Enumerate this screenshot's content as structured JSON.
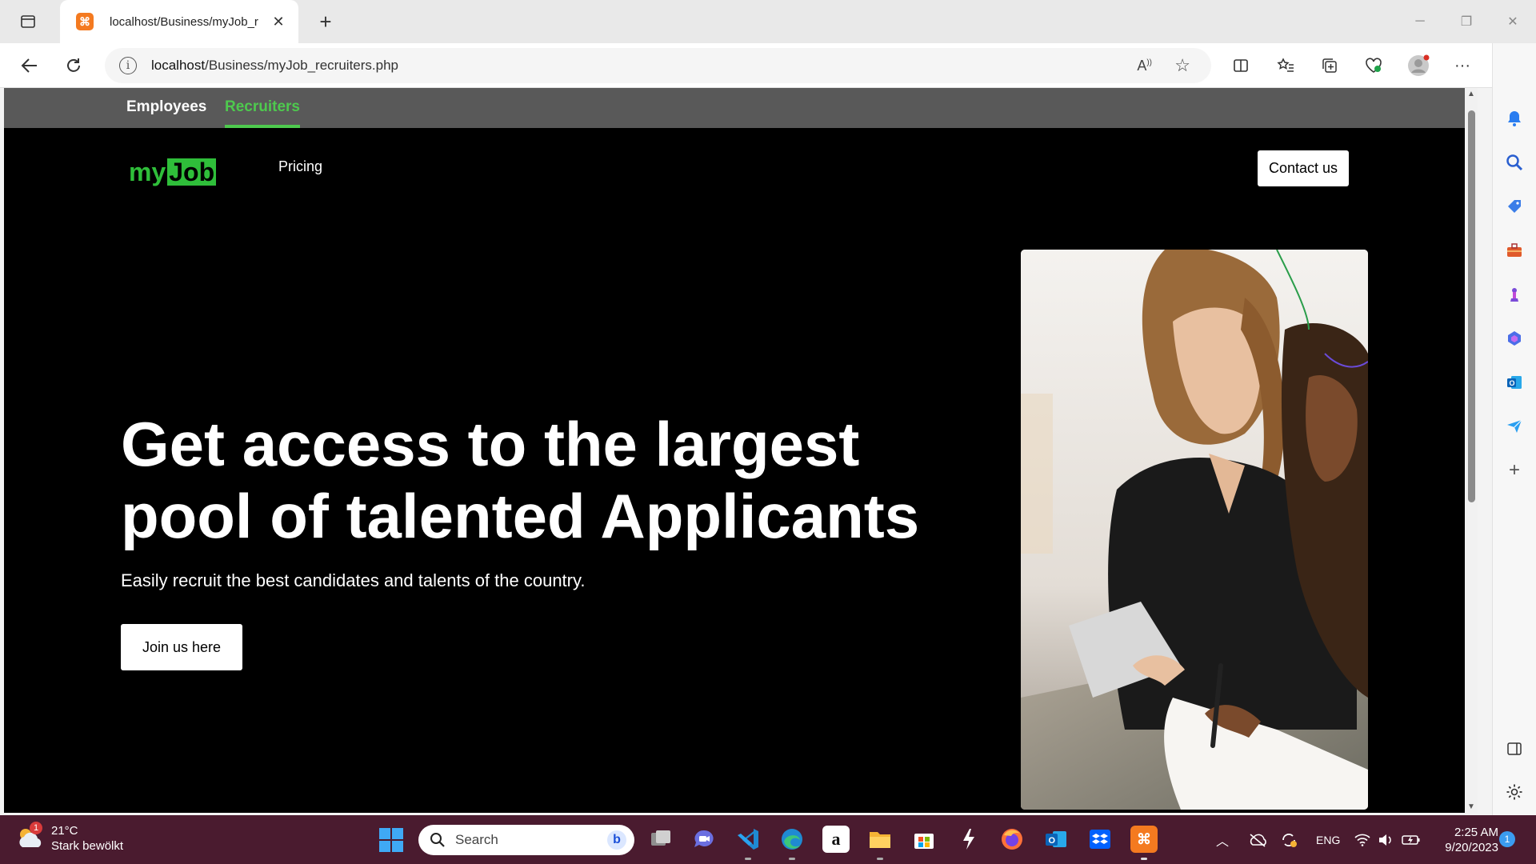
{
  "browser": {
    "tab_title": "localhost/Business/myJob_r",
    "tab_favicon": "xampp-icon",
    "url_host": "localhost",
    "url_path": "/Business/myJob_recruiters.php"
  },
  "site": {
    "nav": {
      "employees": "Employees",
      "recruiters": "Recruiters"
    },
    "logo": {
      "part1": "my",
      "part2": "Job"
    },
    "pricing": "Pricing",
    "contact_label": "Contact us",
    "hero_title": "Get access to the largest pool of talented Applicants",
    "hero_subtitle": "Easily recruit the best candidates and talents of the country.",
    "join_label": "Join us here",
    "accent_color": "#4ec94e"
  },
  "taskbar": {
    "weather_temp": "21°C",
    "weather_desc": "Stark bewölkt",
    "weather_badge": "1",
    "search_placeholder": "Search",
    "language": "ENG",
    "time": "2:25 AM",
    "date": "9/20/2023",
    "notification_count": "1"
  }
}
